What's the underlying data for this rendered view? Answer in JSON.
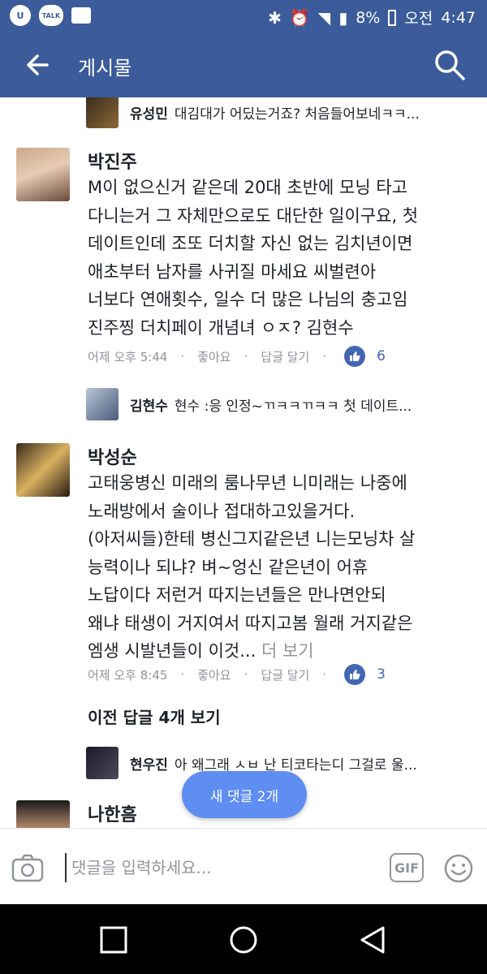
{
  "status_bar": {
    "u_icon": "U",
    "talk_icon": "TALK",
    "battery": "8%",
    "ampm": "오전",
    "time": "4:47"
  },
  "app_bar": {
    "title": "게시물"
  },
  "reply_top": {
    "name": "유성민",
    "text": "대김대가 어딨는거죠? 처음들어보네ㅋㅋ..."
  },
  "comments": [
    {
      "name": "박진주",
      "lines": [
        "M이 없으신거 같은데 20대 초반에 모닝 타고",
        "다니는거 그 자체만으로도 대단한 일이구요, 첫",
        "데이트인데 조또 더치할 자신 없는 김치년이면",
        "애초부터 남자를 사귀질 마세요 씨벌련아",
        "너보다 연애횟수, 일수 더 많은 나님의 충고임",
        "진주찡 더치페이 개념녀 ㅇㅈ? 김현수"
      ],
      "time": "어제 오후 5:44",
      "like": "좋아요",
      "reply": "답글 달기",
      "count": "6"
    },
    {
      "name": "박성순",
      "lines": [
        "고태웅병신 미래의 룸나무년 니미래는 나중에",
        "노래방에서 술이나 접대하고있을거다.",
        "(아저씨들)한테  병신그지같은년 니는모닝차 살",
        "능력이나 되냐? 벼~엉신 같은년이 어휴",
        "노답이다 저런거 따지는년들은 만나면안되",
        "왜냐 태생이 거지여서 따지고봄 월래 거지같은"
      ],
      "last_line": "엠생 시발년들이 이것...",
      "more": "더 보기",
      "time": "어제 오후 8:45",
      "like": "좋아요",
      "reply": "답글 달기",
      "count": "3"
    }
  ],
  "reply_mid": {
    "name": "김현수",
    "text": "현수 :응 인정~ㄲㅋㅋㄲㅋㅋ 첫 데이트..."
  },
  "prev_replies": "이전 답글 4개 보기",
  "reply_bottom": {
    "name": "현우진",
    "text": "아 왜그래 ㅅㅂ 난 티코타는디 그걸로 울..."
  },
  "partial_comment": {
    "name": "나한흠"
  },
  "new_comments_pill": "새 댓글 2개",
  "composer": {
    "placeholder": "댓글을 입력하세요...",
    "gif": "GIF"
  },
  "colors": {
    "brand": "#3b5b9a",
    "like": "#4267b2",
    "pill": "#5e8ef2"
  }
}
